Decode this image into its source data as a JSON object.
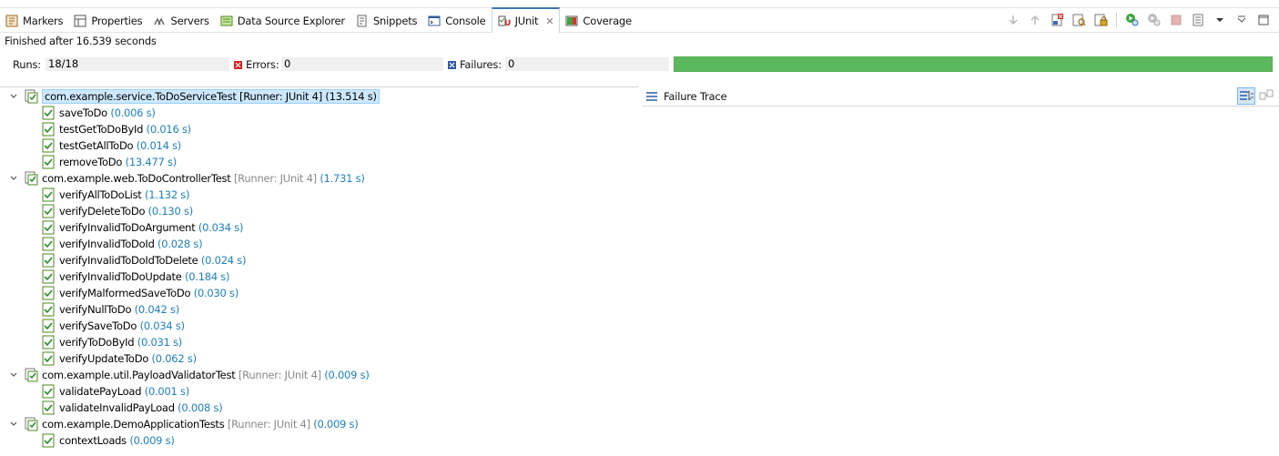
{
  "tabs": [
    {
      "label": "Markers",
      "icon": "markers-icon"
    },
    {
      "label": "Properties",
      "icon": "properties-icon"
    },
    {
      "label": "Servers",
      "icon": "servers-icon"
    },
    {
      "label": "Data Source Explorer",
      "icon": "data-source-icon"
    },
    {
      "label": "Snippets",
      "icon": "snippets-icon"
    },
    {
      "label": "Console",
      "icon": "console-icon"
    },
    {
      "label": "JUnit",
      "icon": "junit-icon",
      "active": true
    },
    {
      "label": "Coverage",
      "icon": "coverage-icon"
    }
  ],
  "toolbar": {
    "icons": [
      "next-failure-icon",
      "previous-failure-icon",
      "show-failures-only-icon",
      "scroll-lock-icon",
      "lock-icon",
      "rerun-icon",
      "rerun-failed-first-icon",
      "stop-icon",
      "history-icon",
      "view-menu-icon",
      "minimize-icon",
      "maximize-icon"
    ]
  },
  "status": "Finished after 16.539 seconds",
  "counters": {
    "runs_label": "Runs:",
    "runs_value": "18/18",
    "errors_label": "Errors:",
    "errors_value": "0",
    "failures_label": "Failures:",
    "failures_value": "0",
    "progress_fraction": 1.0,
    "progress_color": "#5cb85c"
  },
  "tree": {
    "suites": [
      {
        "name": "com.example.service.ToDoServiceTest [Runner: JUnit 4] (13.514 s)",
        "selected": true,
        "tests": [
          {
            "name": "saveToDo",
            "time": "(0.006 s)"
          },
          {
            "name": "testGetToDoById",
            "time": "(0.016 s)"
          },
          {
            "name": "testGetAllToDo",
            "time": "(0.014 s)"
          },
          {
            "name": "removeToDo",
            "time": "(13.477 s)"
          }
        ]
      },
      {
        "name": "com.example.web.ToDoControllerTest",
        "runner": "[Runner: JUnit 4]",
        "time": "(1.731 s)",
        "tests": [
          {
            "name": "verifyAllToDoList",
            "time": "(1.132 s)"
          },
          {
            "name": "verifyDeleteToDo",
            "time": "(0.130 s)"
          },
          {
            "name": "verifyInvalidToDoArgument",
            "time": "(0.034 s)"
          },
          {
            "name": "verifyInvalidToDoId",
            "time": "(0.028 s)"
          },
          {
            "name": "verifyInvalidToDoIdToDelete",
            "time": "(0.024 s)"
          },
          {
            "name": "verifyInvalidToDoUpdate",
            "time": "(0.184 s)"
          },
          {
            "name": "verifyMalformedSaveToDo",
            "time": "(0.030 s)"
          },
          {
            "name": "verifyNullToDo",
            "time": "(0.042 s)"
          },
          {
            "name": "verifySaveToDo",
            "time": "(0.034 s)"
          },
          {
            "name": "verifyToDoById",
            "time": "(0.031 s)"
          },
          {
            "name": "verifyUpdateToDo",
            "time": "(0.062 s)"
          }
        ]
      },
      {
        "name": "com.example.util.PayloadValidatorTest",
        "runner": "[Runner: JUnit 4]",
        "time": "(0.009 s)",
        "tests": [
          {
            "name": "validatePayLoad",
            "time": "(0.001 s)"
          },
          {
            "name": "validateInvalidPayLoad",
            "time": "(0.008 s)"
          }
        ]
      },
      {
        "name": "com.example.DemoApplicationTests",
        "runner": "[Runner: JUnit 4]",
        "time": "(0.009 s)",
        "tests": [
          {
            "name": "contextLoads",
            "time": "(0.009 s)"
          }
        ]
      }
    ]
  },
  "trace": {
    "title": "Failure Trace",
    "icons": [
      "filter-stack-icon",
      "compare-result-icon"
    ]
  }
}
